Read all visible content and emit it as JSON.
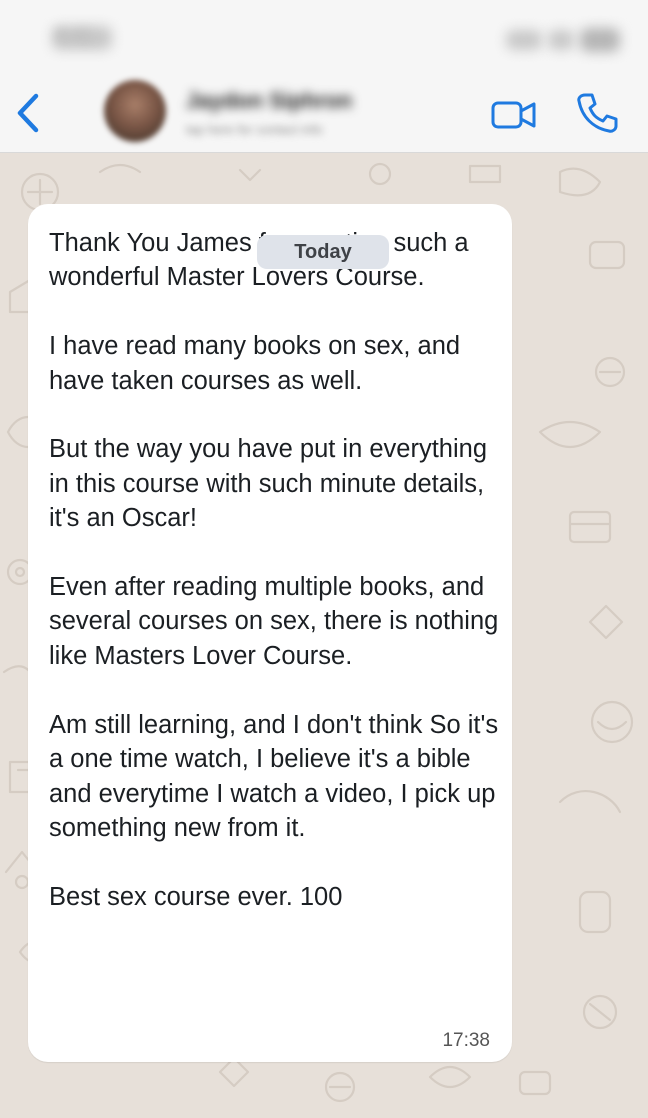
{
  "status_bar": {
    "time": "9:41",
    "icons": [
      "signal-icon",
      "wifi-icon",
      "battery-icon"
    ]
  },
  "header": {
    "contact_name": "Jaydon Siphron",
    "contact_subtitle": "tap here for contact info",
    "back_icon": "chevron-left-icon",
    "video_icon": "video-camera-icon",
    "call_icon": "phone-icon"
  },
  "chat": {
    "date_label": "Today",
    "message": {
      "text": "Thank You James for creating such a wonderful Master Lovers Course.\n\nI have read many books on sex, and have taken courses as well.\n\nBut the way you have put in everything in this course with such minute details, it's an Oscar!\n\nEven after reading multiple books, and several courses on sex, there is nothing like Masters Lover Course.\n\nAm still learning, and I don't think So it's a one time watch, I believe it's a bible and everytime I watch a video, I pick up something new from it.\n\nBest sex course ever. 100",
      "time": "17:38"
    }
  },
  "colors": {
    "accent": "#1f7ae0",
    "wallpaper": "#e7e0d9",
    "bubble": "#ffffff",
    "chip": "#dfe3ea",
    "bar": "#f6f6f6"
  }
}
